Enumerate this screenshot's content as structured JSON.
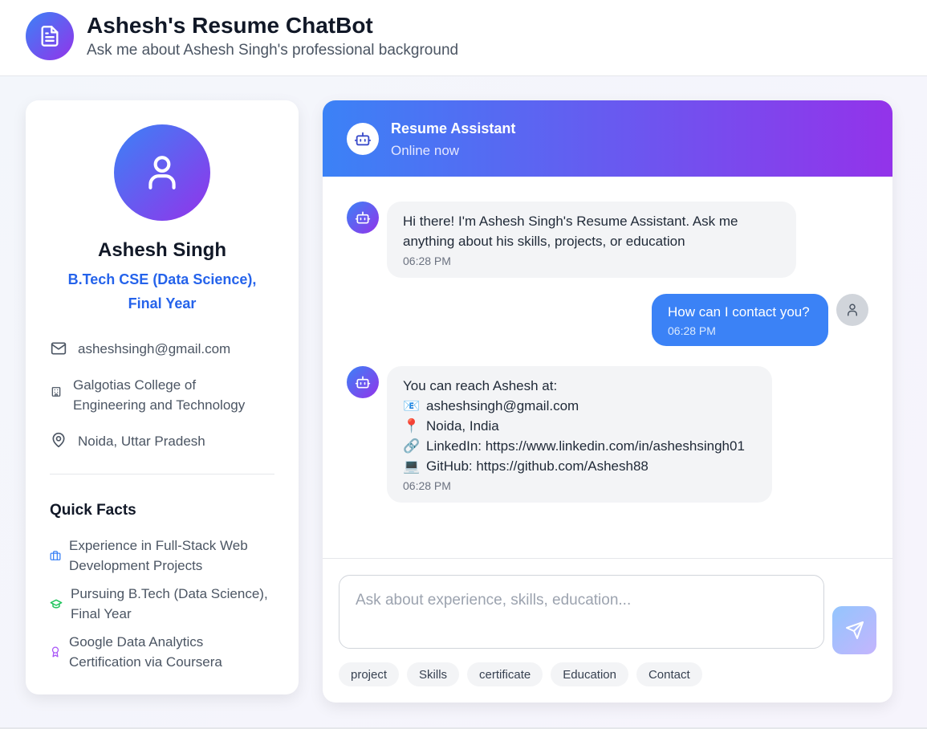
{
  "app": {
    "title": "Ashesh's Resume ChatBot",
    "subtitle": "Ask me about Ashesh Singh's professional background",
    "logo_icon": "document-icon"
  },
  "profile": {
    "name": "Ashesh Singh",
    "degree_line1": "B.Tech CSE (Data Science),",
    "degree_line2": "Final Year",
    "email": "asheshsingh@gmail.com",
    "college_line1": "Galgotias College of",
    "college_line2": "Engineering and Technology",
    "location": "Noida, Uttar Pradesh",
    "quick_facts_title": "Quick Facts",
    "facts": [
      {
        "line1": "Experience in Full-Stack Web",
        "line2": "Development Projects",
        "icon": "briefcase-icon",
        "color": "#3b82f6"
      },
      {
        "line1": "Pursuing B.Tech (Data Science),",
        "line2": "Final Year",
        "icon": "graduation-cap-icon",
        "color": "#22c55e"
      },
      {
        "line1": "Google Data Analytics",
        "line2": "Certification via Coursera",
        "icon": "award-icon",
        "color": "#a855f7"
      }
    ]
  },
  "chat": {
    "title": "Resume Assistant",
    "status": "Online now",
    "messages": [
      {
        "sender": "bot",
        "line1": "Hi there! I'm Ashesh Singh's Resume Assistant. Ask me",
        "line2": "anything about his skills, projects, or education",
        "time": "06:28 PM"
      },
      {
        "sender": "user",
        "text": "How can I contact you?",
        "time": "06:28 PM"
      },
      {
        "sender": "bot",
        "intro": "You can reach Ashesh at:",
        "email": "asheshsingh@gmail.com",
        "location": "Noida, India",
        "linkedin": "LinkedIn: https://www.linkedin.com/in/asheshsingh01",
        "github": "GitHub: https://github.com/Ashesh88",
        "emoji_email": "📧",
        "emoji_location": "📍",
        "emoji_linkedin": "🔗",
        "emoji_github": "💻",
        "time": "06:28 PM"
      }
    ],
    "input_placeholder": "Ask about experience, skills, education...",
    "chips": [
      "project",
      "Skills",
      "certificate",
      "Education",
      "Contact"
    ]
  },
  "colors": {
    "accent_blue": "#3b82f6",
    "accent_purple": "#9333ea",
    "degree_blue": "#2563eb"
  }
}
